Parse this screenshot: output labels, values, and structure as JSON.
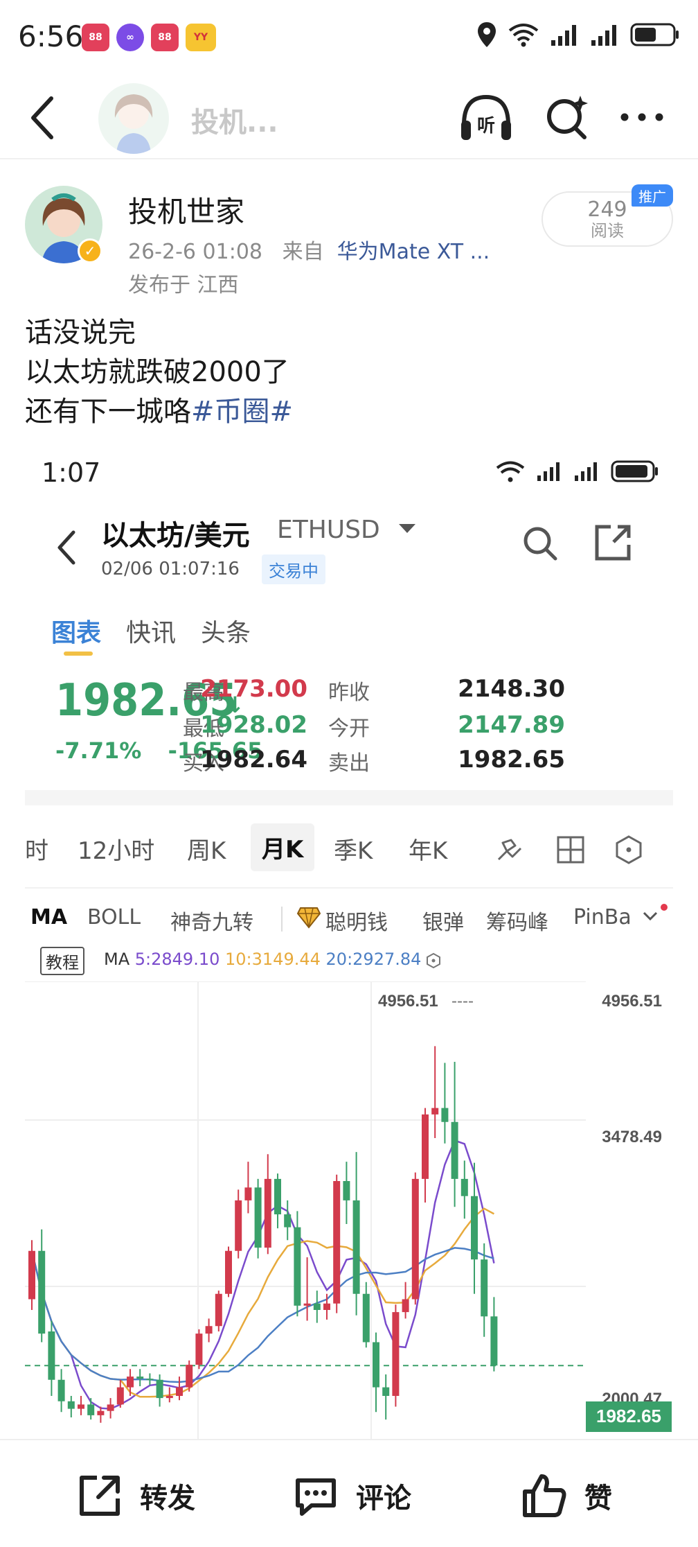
{
  "status_bar": {
    "time": "6:56"
  },
  "nav": {
    "title": "投机..."
  },
  "post": {
    "author": "投机世家",
    "timestamp": "26-2-6 01:08",
    "from_label": "来自",
    "device": "华为Mate XT ...",
    "location": "发布于 江西",
    "reads_count": "249",
    "reads_label": "阅读",
    "promo_tag": "推广",
    "lines": [
      "话没说完",
      "以太坊就跌破2000了",
      "还有下一城咯"
    ],
    "topic": "#币圈#"
  },
  "screenshot": {
    "time": "1:07",
    "title": "以太坊/美元",
    "symbol": "ETHUSD",
    "date": "02/06 01:07:16",
    "trading_status": "交易中",
    "tabs": [
      "图表",
      "快讯",
      "头条"
    ],
    "price": "1982.65",
    "arrow": "↓",
    "change_pct": "-7.71%",
    "change_abs": "-165.65",
    "quotes": [
      {
        "label": "最高",
        "value": "2173.00",
        "color": "red"
      },
      {
        "label": "昨收",
        "value": "2148.30",
        "color": "black"
      },
      {
        "label": "最低",
        "value": "1928.02",
        "color": "green"
      },
      {
        "label": "今开",
        "value": "2147.89",
        "color": "green"
      },
      {
        "label": "买入",
        "value": "1982.64",
        "color": "black"
      },
      {
        "label": "卖出",
        "value": "1982.65",
        "color": "black"
      }
    ],
    "periods": [
      "时",
      "12小时",
      "周K",
      "月K",
      "季K",
      "年K"
    ],
    "active_period": "月K",
    "indicators": [
      "MA",
      "BOLL",
      "神奇九转",
      "聪明钱",
      "银弹",
      "筹码峰",
      "PinBa"
    ],
    "tutorial_label": "教程",
    "ma_label": "MA",
    "ma5": "5:2849.10",
    "ma10": "10:3149.44",
    "ma20": "20:2927.84"
  },
  "chart_data": {
    "type": "candlestick",
    "price_labels": {
      "high_marker": "4956.51",
      "axis_top": "4956.51",
      "axis_mid": "3478.49",
      "axis_low_partial": "2000.47",
      "current": "1982.65"
    },
    "ylim": [
      1300,
      5300
    ],
    "candles": [
      {
        "o": 2600,
        "c": 3050,
        "h": 3150,
        "l": 2500
      },
      {
        "o": 3050,
        "c": 2280,
        "h": 3250,
        "l": 2200
      },
      {
        "o": 2300,
        "c": 1850,
        "h": 2400,
        "l": 1700
      },
      {
        "o": 1850,
        "c": 1650,
        "h": 1950,
        "l": 1550
      },
      {
        "o": 1650,
        "c": 1580,
        "h": 1700,
        "l": 1500
      },
      {
        "o": 1580,
        "c": 1620,
        "h": 1700,
        "l": 1520
      },
      {
        "o": 1620,
        "c": 1520,
        "h": 1680,
        "l": 1480
      },
      {
        "o": 1520,
        "c": 1560,
        "h": 1600,
        "l": 1450
      },
      {
        "o": 1560,
        "c": 1620,
        "h": 1680,
        "l": 1490
      },
      {
        "o": 1620,
        "c": 1780,
        "h": 1850,
        "l": 1590
      },
      {
        "o": 1780,
        "c": 1880,
        "h": 1950,
        "l": 1700
      },
      {
        "o": 1880,
        "c": 1860,
        "h": 1950,
        "l": 1790
      },
      {
        "o": 1860,
        "c": 1850,
        "h": 1910,
        "l": 1800
      },
      {
        "o": 1850,
        "c": 1680,
        "h": 1900,
        "l": 1600
      },
      {
        "o": 1680,
        "c": 1700,
        "h": 1780,
        "l": 1640
      },
      {
        "o": 1700,
        "c": 1780,
        "h": 1880,
        "l": 1660
      },
      {
        "o": 1780,
        "c": 1990,
        "h": 2030,
        "l": 1740
      },
      {
        "o": 1990,
        "c": 2280,
        "h": 2320,
        "l": 1950
      },
      {
        "o": 2280,
        "c": 2350,
        "h": 2420,
        "l": 2200
      },
      {
        "o": 2350,
        "c": 2650,
        "h": 2680,
        "l": 2300
      },
      {
        "o": 2650,
        "c": 3050,
        "h": 3090,
        "l": 2620
      },
      {
        "o": 3050,
        "c": 3520,
        "h": 3620,
        "l": 2980
      },
      {
        "o": 3520,
        "c": 3640,
        "h": 3880,
        "l": 3400
      },
      {
        "o": 3640,
        "c": 3080,
        "h": 3720,
        "l": 2980
      },
      {
        "o": 3080,
        "c": 3720,
        "h": 3950,
        "l": 3020
      },
      {
        "o": 3720,
        "c": 3390,
        "h": 3770,
        "l": 3260
      },
      {
        "o": 3390,
        "c": 3270,
        "h": 3520,
        "l": 3150
      },
      {
        "o": 3270,
        "c": 2540,
        "h": 3420,
        "l": 2440
      },
      {
        "o": 2540,
        "c": 2560,
        "h": 2990,
        "l": 2400
      },
      {
        "o": 2560,
        "c": 2500,
        "h": 2680,
        "l": 2380
      },
      {
        "o": 2500,
        "c": 2560,
        "h": 2650,
        "l": 2410
      },
      {
        "o": 2560,
        "c": 3700,
        "h": 3760,
        "l": 2470
      },
      {
        "o": 3700,
        "c": 3520,
        "h": 3880,
        "l": 3300
      },
      {
        "o": 3520,
        "c": 2650,
        "h": 3970,
        "l": 2450
      },
      {
        "o": 2650,
        "c": 2200,
        "h": 2760,
        "l": 2150
      },
      {
        "o": 2200,
        "c": 1780,
        "h": 2290,
        "l": 1550
      },
      {
        "o": 1780,
        "c": 1700,
        "h": 1900,
        "l": 1480
      },
      {
        "o": 1700,
        "c": 2480,
        "h": 2550,
        "l": 1600
      },
      {
        "o": 2480,
        "c": 2600,
        "h": 2760,
        "l": 2420
      },
      {
        "o": 2600,
        "c": 3720,
        "h": 3780,
        "l": 2550
      },
      {
        "o": 3720,
        "c": 4320,
        "h": 4380,
        "l": 3500
      },
      {
        "o": 4320,
        "c": 4380,
        "h": 4956,
        "l": 4100
      },
      {
        "o": 4380,
        "c": 4250,
        "h": 4800,
        "l": 4050
      },
      {
        "o": 4250,
        "c": 3720,
        "h": 4810,
        "l": 3460
      },
      {
        "o": 3720,
        "c": 3560,
        "h": 3890,
        "l": 3350
      },
      {
        "o": 3560,
        "c": 2970,
        "h": 3870,
        "l": 2650
      },
      {
        "o": 2970,
        "c": 2440,
        "h": 3120,
        "l": 2250
      },
      {
        "o": 2440,
        "c": 1982.65,
        "h": 2620,
        "l": 1928.02
      }
    ]
  },
  "bottom": {
    "repost": "转发",
    "comment": "评论",
    "like": "赞"
  },
  "colors": {
    "up": "#d23a4c",
    "down": "#3aa06a",
    "link": "#3b5998",
    "accent": "#3b82d6"
  }
}
